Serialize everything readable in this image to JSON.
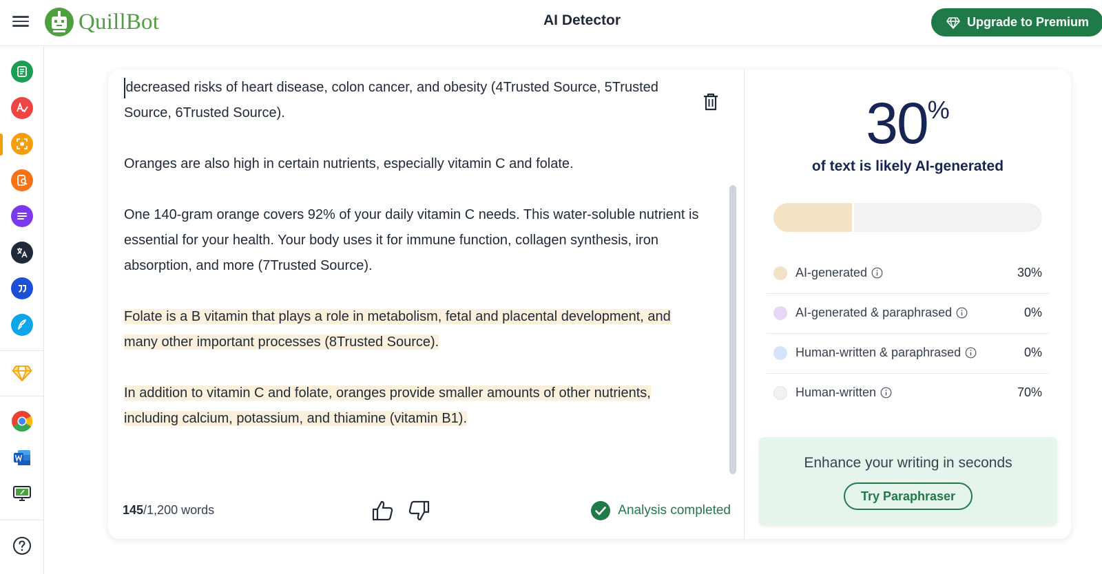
{
  "header": {
    "brand": "QuillBot",
    "title": "AI Detector",
    "upgrade_label": "Upgrade to Premium",
    "brand_color": "#4e9f3d",
    "accent_color": "#1f7a47"
  },
  "sidebar": {
    "tools": [
      {
        "icon": "summarizer-icon",
        "color": "#1f9d55"
      },
      {
        "icon": "grammar-checker-icon",
        "color": "#ef4444"
      },
      {
        "icon": "ai-detector-icon",
        "color": "#f59e0b",
        "active": true
      },
      {
        "icon": "plagiarism-checker-icon",
        "color": "#f97316"
      },
      {
        "icon": "paraphraser-icon",
        "color": "#7c3aed"
      },
      {
        "icon": "translator-icon",
        "color": "#1f2937"
      },
      {
        "icon": "citation-generator-icon",
        "color": "#1d4ed8"
      },
      {
        "icon": "co-writer-icon",
        "color": "#0ea5e9"
      },
      {
        "icon": "premium-diamond-icon",
        "color": "#f59e0b"
      },
      {
        "icon": "chrome-extension-icon",
        "color": "#ea4335"
      },
      {
        "icon": "word-addin-icon",
        "color": "#2b579a"
      },
      {
        "icon": "desktop-app-icon",
        "color": "#1f2937"
      },
      {
        "icon": "help-icon",
        "color": "#1f2937"
      }
    ]
  },
  "editor": {
    "paragraphs": [
      {
        "text": "decreased risks of heart disease, colon cancer, and obesity (4Trusted Source, 5Trusted Source, 6Trusted Source).",
        "highlighted": false
      },
      {
        "text": "Oranges are also high in certain nutrients, especially vitamin C and folate.",
        "highlighted": false
      },
      {
        "text": "One 140-gram orange covers 92% of your daily vitamin C needs. This water-soluble nutrient is essential for your health. Your body uses it for immune function, collagen synthesis, iron absorption, and more (7Trusted Source).",
        "highlighted": false
      },
      {
        "text": "Folate is a B vitamin that plays a role in metabolism, fetal and placental development, and many other important processes (8Trusted Source).",
        "highlighted": true
      },
      {
        "text": "In addition to vitamin C and folate, oranges provide smaller amounts of other nutrients, including calcium, potassium, and thiamine (vitamin B1).",
        "highlighted": true
      }
    ],
    "word_count": "145",
    "word_limit": "/1,200 words",
    "status": "Analysis completed",
    "highlight_color": "#faf0dc"
  },
  "results": {
    "score": "30",
    "score_unit": "%",
    "score_fraction": 0.3,
    "caption": "of text is likely AI-generated",
    "categories": [
      {
        "label": "AI-generated",
        "value": "30%",
        "color": "#f3e2c4"
      },
      {
        "label": "AI-generated & paraphrased",
        "value": "0%",
        "color": "#e9d5f7"
      },
      {
        "label": "Human-written & paraphrased",
        "value": "0%",
        "color": "#d6e4fb"
      },
      {
        "label": "Human-written",
        "value": "70%",
        "color": "#f1f3f2"
      }
    ],
    "promo_text": "Enhance your writing in seconds",
    "promo_button": "Try Paraphraser"
  }
}
